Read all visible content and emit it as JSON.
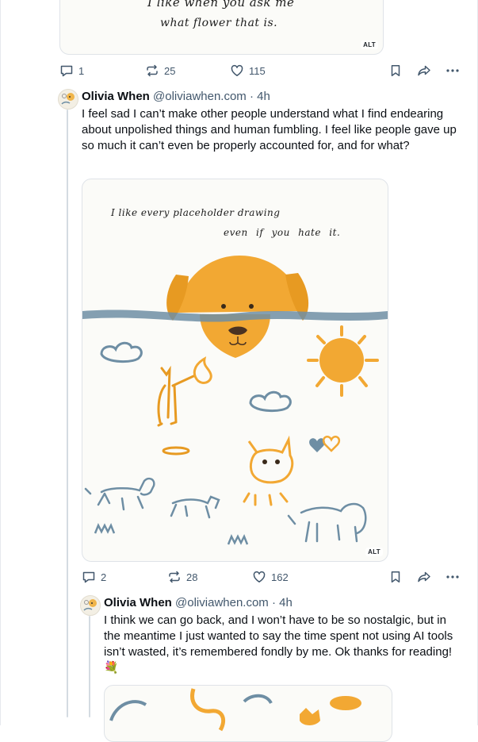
{
  "colors": {
    "text_primary": "#0b0f14",
    "text_secondary": "#42576c",
    "divider": "#e6e9ee",
    "thread_line": "#d4dbe2",
    "drawing_orange": "#f2a833",
    "drawing_blue": "#6e8ea4"
  },
  "top_post": {
    "image": {
      "handwritten_lines": [
        "I like when you ask me",
        "what flower that is."
      ],
      "alt_badge": "ALT"
    },
    "actions": {
      "reply_icon": "speech-bubble-icon",
      "reply_count": "1",
      "repost_icon": "repost-icon",
      "repost_count": "25",
      "like_icon": "heart-icon",
      "like_count": "115",
      "bookmark_icon": "bookmark-icon",
      "share_icon": "share-icon",
      "more_icon": "more-icon"
    }
  },
  "post_2": {
    "author": {
      "name": "Olivia When",
      "handle": "@oliviawhen.com",
      "separator": "·",
      "time": "4h"
    },
    "text": "I feel sad I can’t make other people understand what I find endearing about unpolished things and human fumbling. I feel like people gave up so much it can’t even be properly accounted for, and for what?",
    "image": {
      "handwritten_lines": [
        "I like every placeholder drawing",
        "even if you hate it."
      ],
      "alt_badge": "ALT"
    },
    "actions": {
      "reply_count": "2",
      "repost_count": "28",
      "like_count": "162"
    }
  },
  "post_3": {
    "author": {
      "name": "Olivia When",
      "handle": "@oliviawhen.com",
      "separator": "·",
      "time": "4h"
    },
    "text": "I think we can go back, and I won’t have to be so nostalgic, but in the meantime I just wanted to say the time spent not using AI tools isn’t wasted, it’s remembered fondly by me. Ok thanks for reading! 💐"
  }
}
